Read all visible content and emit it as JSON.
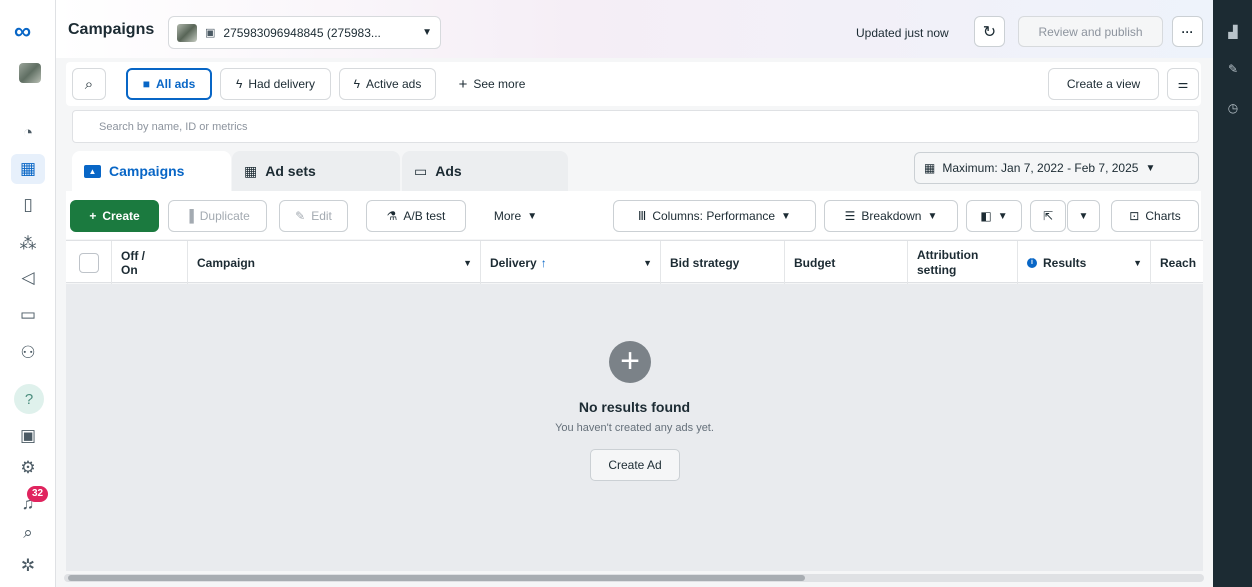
{
  "left_rail": {
    "notification_count": "32"
  },
  "header": {
    "title": "Campaigns",
    "account_id": "275983096948845 (275983...",
    "updated_text": "Updated just now",
    "review_publish_label": "Review and publish",
    "more_label": "···"
  },
  "filters": {
    "all_ads": "All ads",
    "had_delivery": "Had delivery",
    "active_ads": "Active ads",
    "see_more": "See more",
    "create_view": "Create a view"
  },
  "search": {
    "placeholder": "Search by name, ID or metrics"
  },
  "tabs": {
    "campaigns": "Campaigns",
    "ad_sets": "Ad sets",
    "ads": "Ads"
  },
  "date_range": "Maximum: Jan 7, 2022 - Feb 7, 2025",
  "toolbar": {
    "create": "Create",
    "duplicate": "Duplicate",
    "edit": "Edit",
    "ab_test": "A/B test",
    "more": "More",
    "columns": "Columns: Performance",
    "breakdown": "Breakdown",
    "charts": "Charts"
  },
  "table": {
    "col_off_on_1": "Off /",
    "col_off_on_2": "On",
    "col_campaign": "Campaign",
    "col_delivery": "Delivery",
    "col_bid_strategy": "Bid strategy",
    "col_budget": "Budget",
    "col_attribution_1": "Attribution",
    "col_attribution_2": "setting",
    "col_results": "Results",
    "col_reach": "Reach"
  },
  "empty_state": {
    "title": "No results found",
    "subtitle": "You haven't created any ads yet.",
    "button": "Create Ad"
  },
  "colors": {
    "accent": "#0866c6",
    "create_green": "#1b7a3f",
    "badge_red": "#e0245e",
    "right_rail": "#1c2b33"
  }
}
